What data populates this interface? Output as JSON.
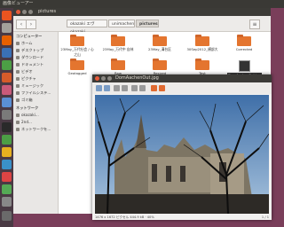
{
  "topbar": {
    "app_name": "画像ビューアー"
  },
  "file_manager": {
    "title": "pictures",
    "breadcrumbs": [
      "okazaki エヴ okazaki",
      "unimachen",
      "pictures"
    ],
    "sidebar": {
      "head_computer": "コンピューター",
      "items": [
        "ホーム",
        "デスクトップ",
        "ダウンロード",
        "ドキュメント",
        "ビデオ",
        "ピクチャ",
        "ミュージック",
        "ファイルシステ...",
        "ゴミ箱"
      ],
      "head_network": "ネットワーク",
      "network_items": [
        "okazaki...",
        "2nd...",
        "ネットワークを..."
      ]
    },
    "files": [
      {
        "name": "23May_万代社会 / 心之山",
        "type": "folder"
      },
      {
        "name": "23May_万代中 自林",
        "type": "folder"
      },
      {
        "name": "23May_溝台区",
        "type": "folder"
      },
      {
        "name": "30Sep2012_横部大",
        "type": "folder"
      },
      {
        "name": "Corrected",
        "type": "folder"
      },
      {
        "name": "Geotagged",
        "type": "folder"
      },
      {
        "name": "Raw",
        "type": "folder"
      },
      {
        "name": "Resized",
        "type": "folder"
      },
      {
        "name": "Test",
        "type": "folder"
      },
      {
        "name": "DomAachenOut.jpg",
        "type": "image"
      }
    ]
  },
  "viewer": {
    "title": "DomAachenOut.jpg",
    "status": "1476 x 1672 ピクセル 444.9 kB · 40%",
    "page": "1 / 1"
  },
  "colors": {
    "folder": "#e4752f",
    "desktop": "#7a3e5a",
    "launcher": "#4a3a44"
  }
}
